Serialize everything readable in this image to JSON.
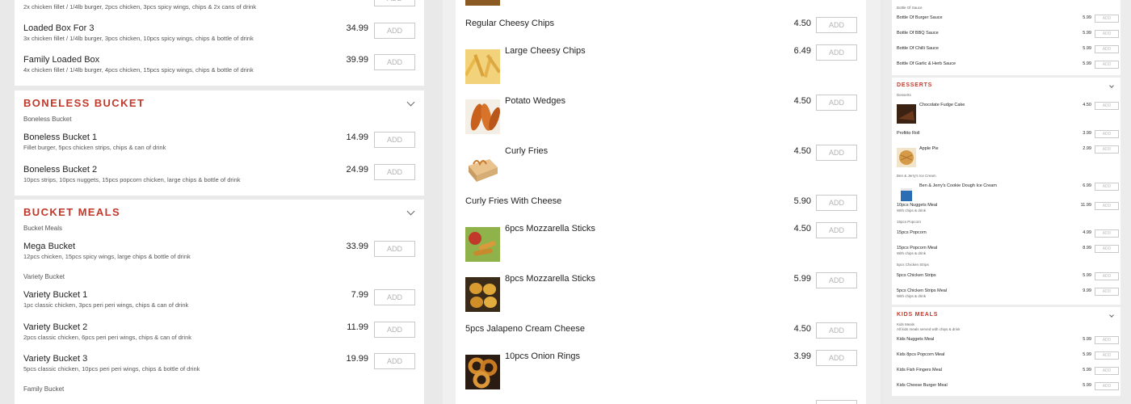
{
  "col1": {
    "top_desc": "2x chicken fillet / 1/4lb burger, 2pcs chicken, 3pcs spicy wings, chips & 2x cans of drink",
    "add_label": "ADD",
    "items_top": [
      {
        "name": "Loaded Box For 3",
        "desc": "3x chicken fillet / 1/4lb burger, 3pcs chicken, 10pcs spicy wings, chips & bottle of drink",
        "price": "34.99"
      },
      {
        "name": "Family Loaded Box",
        "desc": "4x chicken fillet / 1/4lb burger, 4pcs chicken, 15pcs spicy wings, chips & bottle of drink",
        "price": "39.99"
      }
    ],
    "boneless": {
      "title": "BONELESS BUCKET",
      "sub": "Boneless Bucket",
      "items": [
        {
          "name": "Boneless Bucket 1",
          "desc": "Fillet burger, 5pcs chicken strips, chips & can of drink",
          "price": "14.99"
        },
        {
          "name": "Boneless Bucket 2",
          "desc": "10pcs strips, 10pcs nuggets, 15pcs popcorn chicken, large chips & bottle of drink",
          "price": "24.99"
        }
      ]
    },
    "bucket_meals": {
      "title": "BUCKET MEALS",
      "sub": "Bucket Meals",
      "mega": {
        "name": "Mega Bucket",
        "desc": "12pcs chicken, 15pcs spicy wings, large chips & bottle of drink",
        "price": "33.99"
      },
      "variety_sub": "Variety Bucket",
      "items": [
        {
          "name": "Variety Bucket 1",
          "desc": "1pc classic chicken, 3pcs peri peri wings, chips & can of drink",
          "price": "7.99"
        },
        {
          "name": "Variety Bucket 2",
          "desc": "2pcs classic chicken, 6pcs peri peri wings, chips & can of drink",
          "price": "11.99"
        },
        {
          "name": "Variety Bucket 3",
          "desc": "5pcs classic chicken, 10pcs peri peri wings, chips & bottle of drink",
          "price": "19.99"
        }
      ],
      "family_sub": "Family Bucket"
    }
  },
  "col2": {
    "items": [
      {
        "name": "Regular Cheesy Chips",
        "price": "4.50"
      },
      {
        "name": "Large Cheesy Chips",
        "price": "6.49"
      },
      {
        "name": "Potato Wedges",
        "price": "4.50"
      },
      {
        "name": "Curly Fries",
        "price": "4.50"
      },
      {
        "name": "Curly Fries With Cheese",
        "price": "5.90"
      },
      {
        "name": "6pcs Mozzarella Sticks",
        "price": "4.50"
      },
      {
        "name": "8pcs Mozzarella Sticks",
        "price": "5.99"
      },
      {
        "name": "5pcs Jalapeno Cream Cheese",
        "price": "4.50"
      },
      {
        "name": "10pcs Onion Rings",
        "price": "3.99"
      }
    ]
  },
  "col3": {
    "sauce_sub": "Bottle Of Sauce",
    "sauces": [
      {
        "name": "Bottle Of Burger Sauce",
        "price": "5.99"
      },
      {
        "name": "Bottle Of BBQ Sauce",
        "price": "5.99"
      },
      {
        "name": "Bottle Of Chilli Sauce",
        "price": "5.99"
      },
      {
        "name": "Bottle Of Garlic & Herb Sauce",
        "price": "5.99"
      }
    ],
    "desserts_title": "DESSERTS",
    "desserts_sub": "Desserts",
    "desserts": [
      {
        "name": "Chocolate Fudge Cake",
        "price": "4.50"
      },
      {
        "name": "Profitto Roll",
        "price": "3.99"
      },
      {
        "name": "Apple Pie",
        "price": "2.99"
      }
    ],
    "bj_sub": "Ben & Jerry's Ice Cream",
    "bj_item": {
      "name": "Ben & Jerry's Cookie Dough Ice Cream",
      "price": "6.99"
    },
    "nuggets_meal": {
      "name": "10pcs Nuggets Meal",
      "desc": "With chips & drink",
      "price": "11.99"
    },
    "popcorn_sub": "15pcs Popcorn",
    "popcorn": {
      "name": "15pcs Popcorn",
      "price": "4.99"
    },
    "popcorn_meal": {
      "name": "15pcs Popcorn Meal",
      "desc": "With chips & drink",
      "price": "8.99"
    },
    "strips_sub": "5pcs Chicken Strips",
    "strips": {
      "name": "5pcs Chicken Strips",
      "price": "5.99"
    },
    "strips_meal": {
      "name": "5pcs Chicken Strips Meal",
      "desc": "With chips & drink",
      "price": "9.99"
    },
    "kids_title": "KIDS MEALS",
    "kids_sub": "Kids Meals",
    "kids_note": "All kids meals served with chips & drink",
    "kids": [
      {
        "name": "Kids Nuggets Meal",
        "price": "5.99"
      },
      {
        "name": "Kids 8pcs Popcorn Meal",
        "price": "5.99"
      },
      {
        "name": "Kids Fish Fingers Meal",
        "price": "5.99"
      },
      {
        "name": "Kids Cheese Burger Meal",
        "price": "5.99"
      }
    ]
  },
  "colors": {
    "accent": "#c0392b",
    "panel": "#ffffff",
    "bg": "#e9e9e9"
  }
}
